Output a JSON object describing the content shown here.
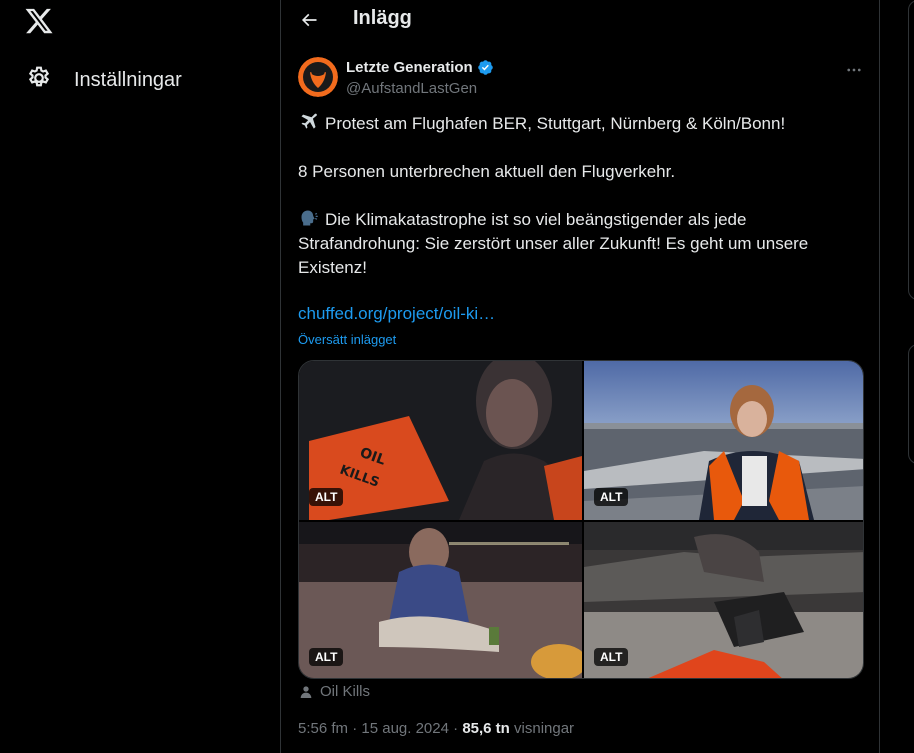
{
  "nav": {
    "settings_label": "Inställningar"
  },
  "header": {
    "title": "Inlägg"
  },
  "tweet": {
    "author_name": "Letzte Generation",
    "author_handle": "@AufstandLastGen",
    "line1": "Protest am Flughafen BER, Stuttgart, Nürnberg & Köln/Bonn!",
    "line2": "8 Personen unterbrechen aktuell den Flugverkehr.",
    "line3": "Die Klimakatastrophe ist so viel beängstigender als jede Strafandrohung: Sie zerstört unser aller Zukunft! Es geht um unsere Existenz!",
    "link": "chuffed.org/project/oil-ki…",
    "translate": "Översätt inlägget",
    "alt_label": "ALT",
    "tagged": "Oil Kills",
    "time": "5:56 fm",
    "date": "15 aug. 2024",
    "views_count": "85,6 tn",
    "views_label": "visningar",
    "separator": "·"
  },
  "colors": {
    "accent": "#1d9bf0",
    "muted": "#71767b",
    "border": "#2f3336",
    "vest_orange": "#e8590c"
  },
  "icons": [
    "x-logo-icon",
    "gear-icon",
    "back-arrow-icon",
    "verified-icon",
    "more-icon",
    "airplane-icon",
    "speaking-head-icon",
    "person-icon"
  ]
}
